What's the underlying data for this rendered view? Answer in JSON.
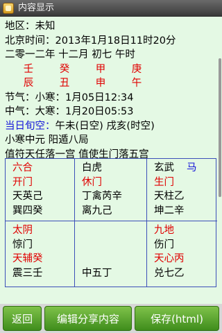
{
  "window": {
    "title": "内容显示",
    "app_icon": "folder-icon"
  },
  "info": {
    "area": "地区：未知",
    "beijing_time": "北京时间：2013年1月18日11时20分",
    "lunar": "二零一二年 十二月 初七 午时",
    "pillars_top": [
      "壬",
      "癸",
      "甲",
      "庚"
    ],
    "pillars_bottom": [
      "辰",
      "丑",
      "申",
      "午"
    ],
    "jieqi": "节气：小寒：1月05日12:34",
    "zhongqi": "中气：大寒：1月20日05:53",
    "xunkong_label": "当日旬空：",
    "xunkong_value": "午未(日空)   戌亥(时空)",
    "yuan_ju": "小寒中元   阳遁八局",
    "zhifu": "值符天任落一宫 值使生门落五宫"
  },
  "colors": {
    "red": "#e00000",
    "blue": "#1515d9",
    "background": "#e4f9e4",
    "button": "#4fa12a"
  },
  "palace": {
    "p1": {
      "l1": "六合",
      "l2": "开门",
      "l3": "天英己",
      "l4": "巽四癸"
    },
    "p2": {
      "l1": "白虎",
      "l2": "休门",
      "l3": "丁禽芮辛",
      "l4": "离九己"
    },
    "p3": {
      "l1": "玄武",
      "horse": "马",
      "l2": "生门",
      "l3": "天柱乙",
      "l4": "坤二辛"
    },
    "p4": {
      "l1": "太阴",
      "l2": "惊门",
      "l3": "天辅癸",
      "l4": "震三壬"
    },
    "p5": {
      "l1": "中五丁"
    },
    "p6": {
      "l1": "九地",
      "l2": "伤门",
      "l3": "天心丙",
      "l4": "兑七乙"
    }
  },
  "buttons": {
    "back": "返回",
    "edit_share": "编辑分享内容",
    "save": "保存(html)"
  }
}
